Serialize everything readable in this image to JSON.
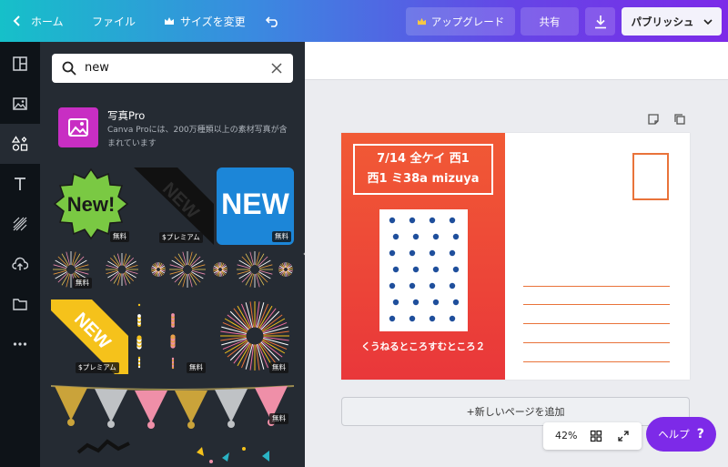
{
  "topbar": {
    "home": "ホーム",
    "file": "ファイル",
    "resize": "サイズを変更",
    "upgrade": "アップグレード",
    "share": "共有",
    "publish": "パブリッシュ"
  },
  "search": {
    "value": "new"
  },
  "promo": {
    "title": "写真Pro",
    "desc": "Canva Proには、200万種類以上の素材写真が含まれています"
  },
  "tiles": {
    "free": "無料",
    "premium": "$プレミアム",
    "new_badge_text": "New!",
    "new_ribbon_text": "NEW",
    "new_blue_text": "NEW"
  },
  "design": {
    "title_line1": "7/14 全ケイ 西1",
    "title_line2": "西1 ミ38a mizuya",
    "booklet_text": "くうねる\nところ\nすむ\nところ",
    "caption": "くうねるところすむところ２"
  },
  "canvas": {
    "add_page": "+新しいページを追加",
    "zoom": "42%",
    "help": "ヘルプ",
    "help_q": "?"
  },
  "colors": {
    "brand_purple": "#7d2ae8",
    "postcard_orange": "#e9733a",
    "panel_bg": "#252b33"
  },
  "icons": [
    "chevron-left-icon",
    "crown-icon",
    "undo-icon",
    "download-icon",
    "chevron-down-icon",
    "layout-icon",
    "image-icon",
    "elements-icon",
    "text-icon",
    "background-icon",
    "upload-icon",
    "folder-icon",
    "more-icon",
    "search-icon",
    "clear-icon",
    "notes-icon",
    "duplicate-icon",
    "grid-icon",
    "expand-icon"
  ]
}
